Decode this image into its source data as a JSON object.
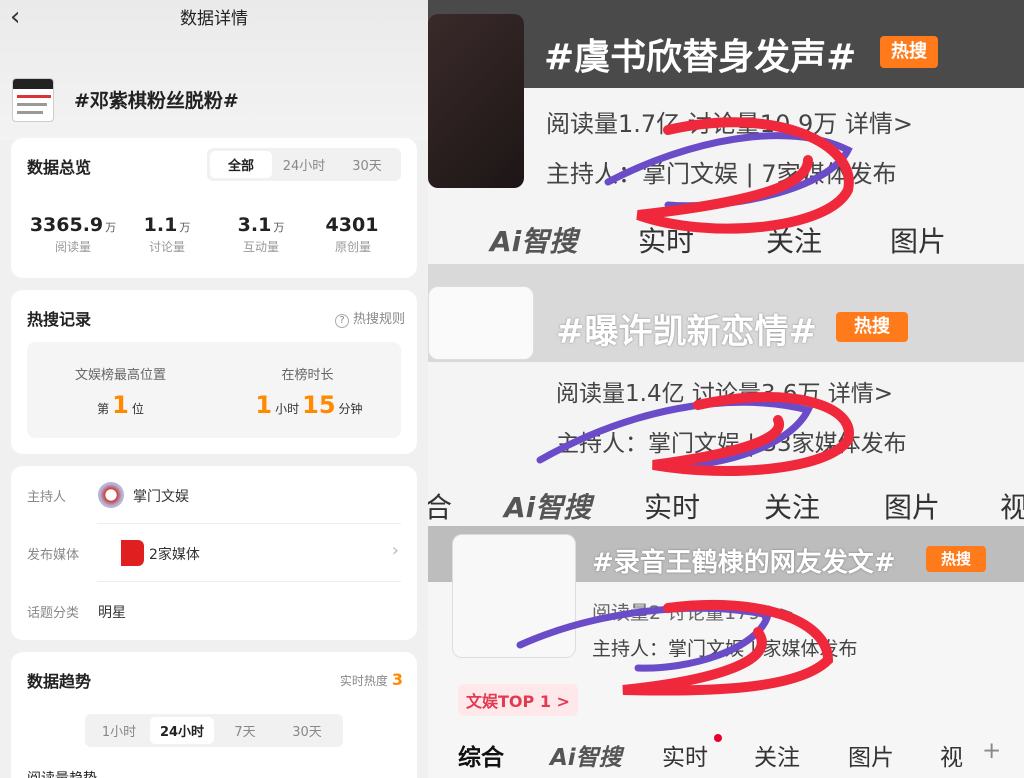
{
  "left": {
    "back_icon": "chevron-left-icon",
    "page_title": "数据详情",
    "topic": "#邓紫棋粉丝脱粉#",
    "overview": {
      "title": "数据总览",
      "tabs": [
        "全部",
        "24小时",
        "30天"
      ],
      "selected_tab": "全部",
      "stats": [
        {
          "value": "3365.9",
          "unit": "万",
          "label": "阅读量"
        },
        {
          "value": "1.1",
          "unit": "万",
          "label": "讨论量"
        },
        {
          "value": "3.1",
          "unit": "万",
          "label": "互动量"
        },
        {
          "value": "4301",
          "unit": "",
          "label": "原创量"
        }
      ]
    },
    "hot_record": {
      "title": "热搜记录",
      "rule_icon": "question-circle-icon",
      "rule_label": "热搜规则",
      "rank_label": "文娱榜最高位置",
      "rank_prefix": "第",
      "rank_value": "1",
      "rank_suffix": "位",
      "duration_label": "在榜时长",
      "hours": "1",
      "hours_unit": "小时",
      "minutes": "15",
      "minutes_unit": "分钟"
    },
    "info": {
      "host_label": "主持人",
      "host_value": "掌门文娱",
      "media_label": "发布媒体",
      "media_value": "2家媒体",
      "category_label": "话题分类",
      "category_value": "明星"
    },
    "trend": {
      "title": "数据趋势",
      "heat_label": "实时热度",
      "heat_value": "3",
      "tabs": [
        "1小时",
        "24小时",
        "7天",
        "30天"
      ],
      "selected_tab": "24小时",
      "read_trend_label": "阅读量趋势"
    }
  },
  "right": {
    "panels": [
      {
        "title": "#虞书欣替身发声#",
        "badge": "热搜",
        "meta1": "阅读量1.7亿  讨论量10.9万  详情>",
        "meta2": "主持人：掌门文娱 | 7家媒体发布",
        "tabs": [
          "Ai智搜",
          "实时",
          "关注",
          "图片"
        ]
      },
      {
        "title": "#曝许凯新恋情#",
        "badge": "热搜",
        "meta1": "阅读量1.4亿  讨论量3.6万  详情>",
        "meta2": "主持人：掌门文娱 | 33家媒体发布",
        "tabs": [
          "合",
          "Ai智搜",
          "实时",
          "关注",
          "图片",
          "视"
        ]
      },
      {
        "title": "#录音王鹤棣的网友发文#",
        "badge": "热搜",
        "meta1": "阅读量2  讨论量1795  >",
        "meta2": "主持人：掌门文娱 | 家媒体发布",
        "top_badge": "文娱TOP 1 >",
        "tabs": [
          "综合",
          "Ai智搜",
          "实时",
          "关注",
          "图片",
          "视",
          "+"
        ]
      }
    ],
    "scribble_colors": {
      "red": "#f0283c",
      "purple": "#6a4cc8"
    }
  }
}
